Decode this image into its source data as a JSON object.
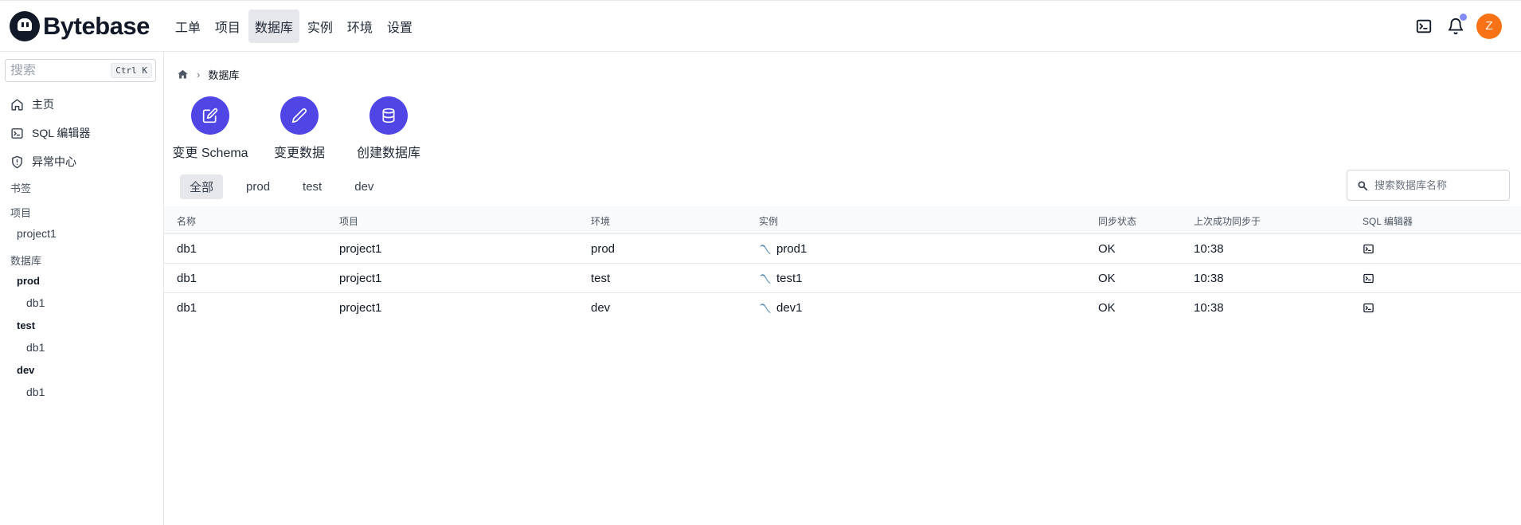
{
  "brand": {
    "name": "Bytebase"
  },
  "nav": [
    {
      "label": "工单",
      "active": false
    },
    {
      "label": "项目",
      "active": false
    },
    {
      "label": "数据库",
      "active": true
    },
    {
      "label": "实例",
      "active": false
    },
    {
      "label": "环境",
      "active": false
    },
    {
      "label": "设置",
      "active": false
    }
  ],
  "user": {
    "avatar_letter": "Z",
    "avatar_color": "#f97316"
  },
  "sidebar": {
    "search_placeholder": "搜索",
    "shortcut": "Ctrl K",
    "links": [
      "主页",
      "SQL 编辑器",
      "异常中心"
    ],
    "bookmarks_label": "书签",
    "projects_label": "项目",
    "projects": [
      "project1"
    ],
    "databases_label": "数据库",
    "envs": [
      {
        "name": "prod",
        "dbs": [
          "db1"
        ]
      },
      {
        "name": "test",
        "dbs": [
          "db1"
        ]
      },
      {
        "name": "dev",
        "dbs": [
          "db1"
        ]
      }
    ]
  },
  "breadcrumb": {
    "current": "数据库"
  },
  "actions": [
    "变更 Schema",
    "变更数据",
    "创建数据库"
  ],
  "accent_color": "#4f46e5",
  "tabs": [
    {
      "label": "全部",
      "active": true
    },
    {
      "label": "prod",
      "active": false
    },
    {
      "label": "test",
      "active": false
    },
    {
      "label": "dev",
      "active": false
    }
  ],
  "db_search_placeholder": "搜索数据库名称",
  "table": {
    "headers": [
      "名称",
      "项目",
      "环境",
      "实例",
      "同步状态",
      "上次成功同步于",
      "SQL 编辑器"
    ],
    "rows": [
      {
        "name": "db1",
        "project": "project1",
        "env": "prod",
        "instance": "prod1",
        "status": "OK",
        "synced": "10:38"
      },
      {
        "name": "db1",
        "project": "project1",
        "env": "test",
        "instance": "test1",
        "status": "OK",
        "synced": "10:38"
      },
      {
        "name": "db1",
        "project": "project1",
        "env": "dev",
        "instance": "dev1",
        "status": "OK",
        "synced": "10:38"
      }
    ]
  }
}
